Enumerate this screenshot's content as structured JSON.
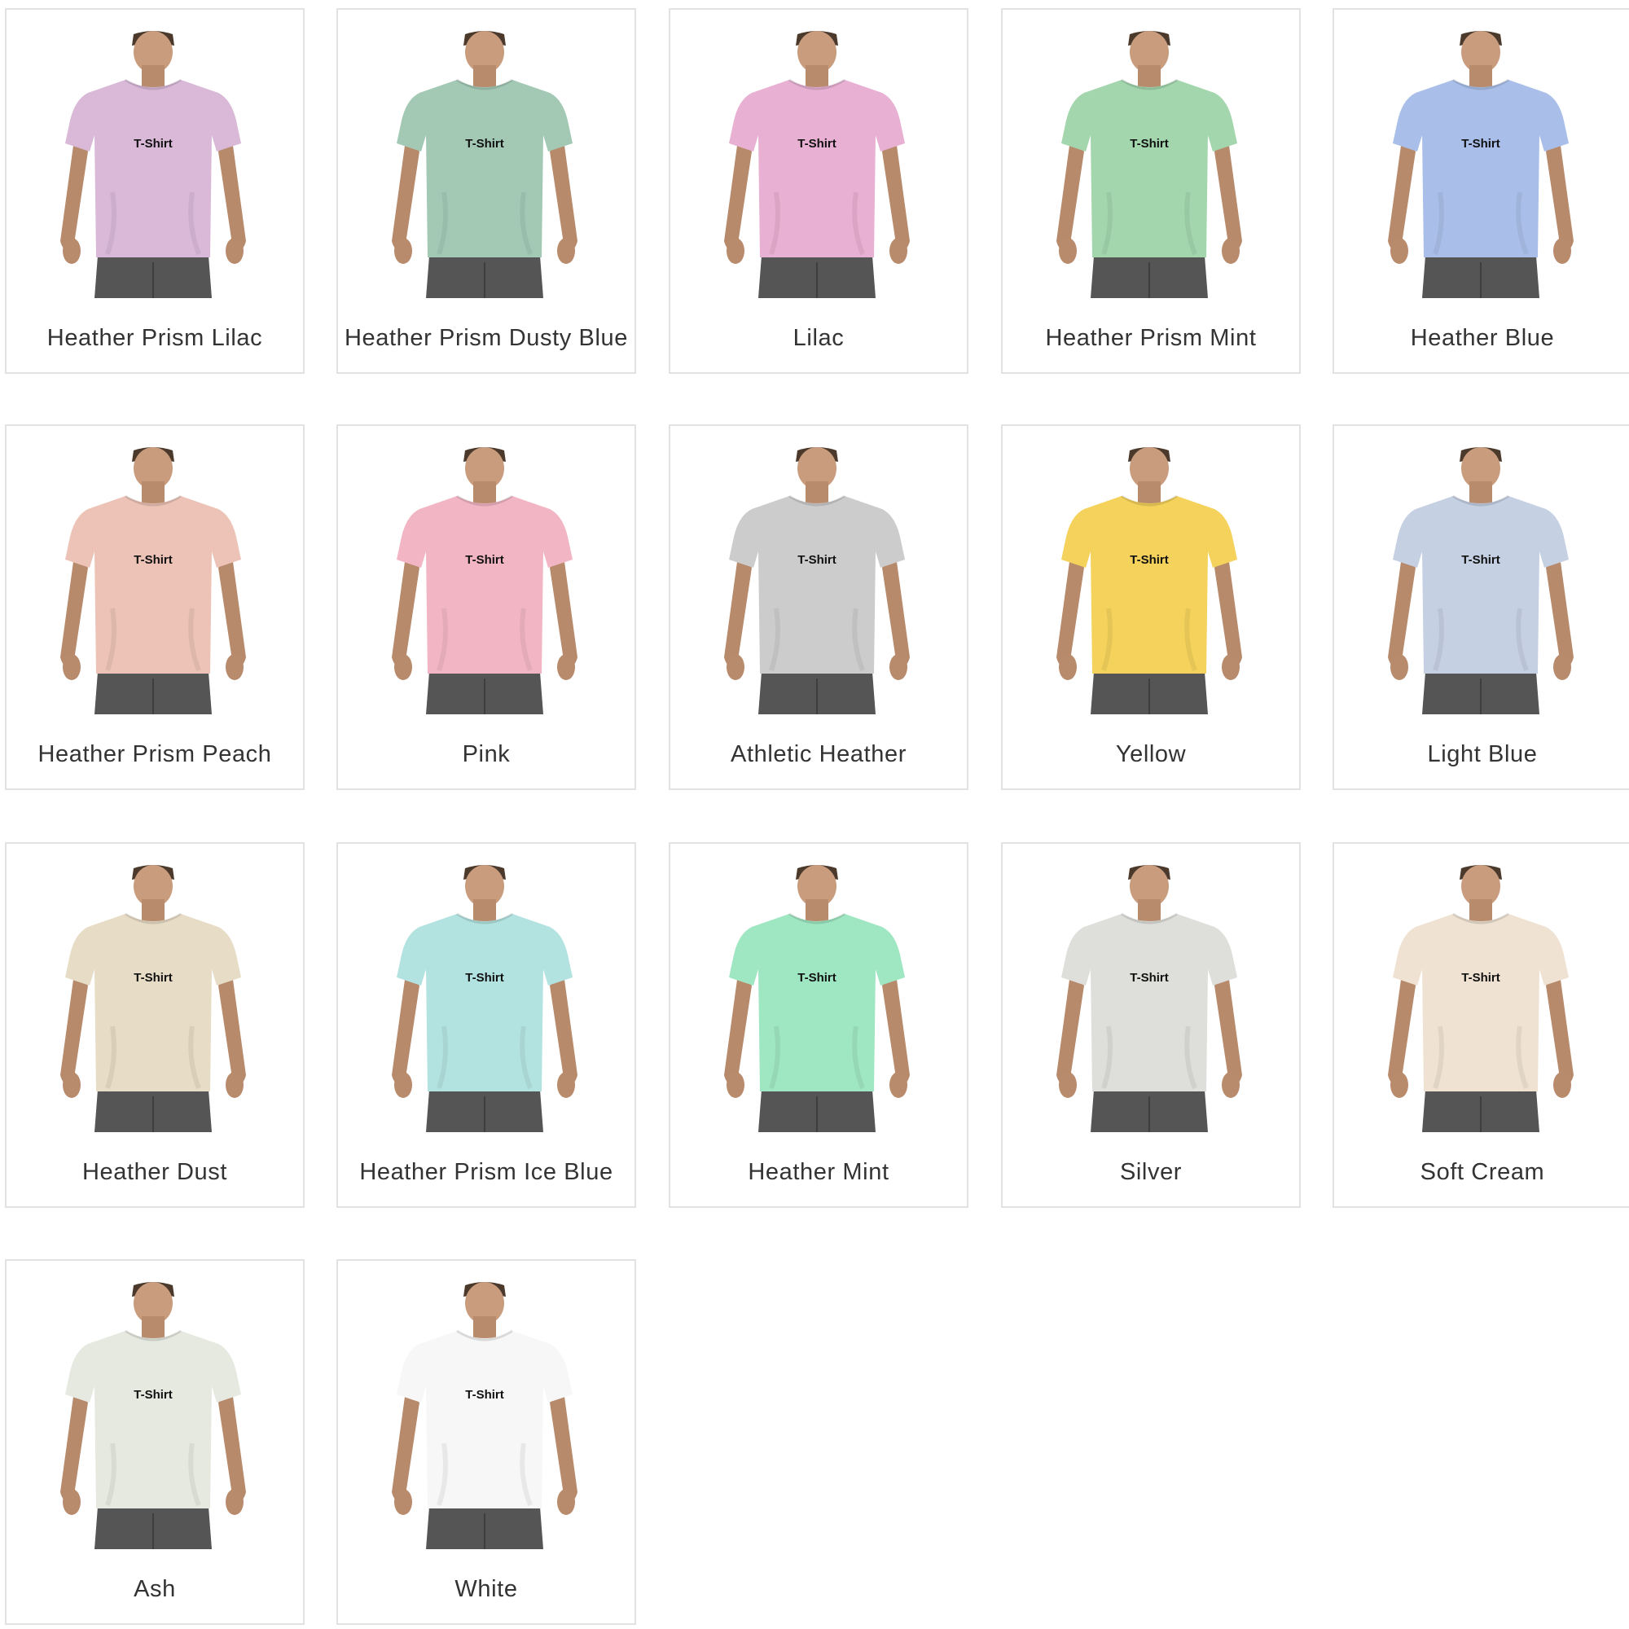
{
  "swatches": [
    {
      "name": "Heather Prism Lilac",
      "shirt_text": "T-Shirt",
      "color": "#d9b8d8"
    },
    {
      "name": "Heather Prism Dusty Blue",
      "shirt_text": "T-Shirt",
      "color": "#a3c9b5"
    },
    {
      "name": "Lilac",
      "shirt_text": "T-Shirt",
      "color": "#e8b0d2"
    },
    {
      "name": "Heather Prism Mint",
      "shirt_text": "T-Shirt",
      "color": "#a3d6ad"
    },
    {
      "name": "Heather Blue",
      "shirt_text": "T-Shirt",
      "color": "#a9bfe9"
    },
    {
      "name": "Heather Prism Peach",
      "shirt_text": "T-Shirt",
      "color": "#ecc3b6"
    },
    {
      "name": "Pink",
      "shirt_text": "T-Shirt",
      "color": "#f2b5c4"
    },
    {
      "name": "Athletic Heather",
      "shirt_text": "T-Shirt",
      "color": "#cccccc"
    },
    {
      "name": "Yellow",
      "shirt_text": "T-Shirt",
      "color": "#f4d25b"
    },
    {
      "name": "Light Blue",
      "shirt_text": "T-Shirt",
      "color": "#c5d0e3"
    },
    {
      "name": "Heather Dust",
      "shirt_text": "T-Shirt",
      "color": "#e7dcc5"
    },
    {
      "name": "Heather Prism Ice Blue",
      "shirt_text": "T-Shirt",
      "color": "#b3e3e0"
    },
    {
      "name": "Heather Mint",
      "shirt_text": "T-Shirt",
      "color": "#9fe6c2"
    },
    {
      "name": "Silver",
      "shirt_text": "T-Shirt",
      "color": "#dededa"
    },
    {
      "name": "Soft Cream",
      "shirt_text": "T-Shirt",
      "color": "#efe2d2"
    },
    {
      "name": "Ash",
      "shirt_text": "T-Shirt",
      "color": "#e6e9df"
    },
    {
      "name": "White",
      "shirt_text": "T-Shirt",
      "color": "#f7f7f7"
    }
  ]
}
